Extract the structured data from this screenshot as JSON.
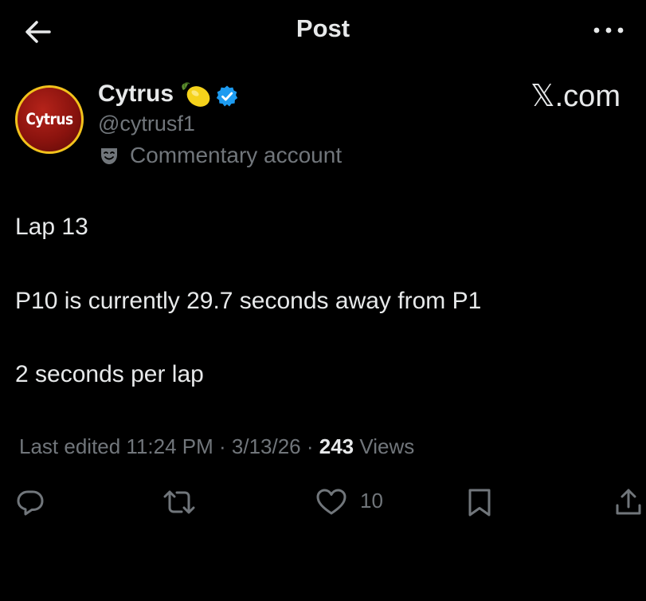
{
  "header": {
    "title": "Post",
    "back_icon": "arrow-left-icon",
    "more_icon": "more-horizontal-icon"
  },
  "author": {
    "avatar_text": "Cytrus",
    "display_name": "Cytrus",
    "name_emoji": "lemon-icon",
    "verified_icon": "verified-badge-icon",
    "handle": "@cytrusf1",
    "account_label_icon": "theater-mask-icon",
    "account_label": "Commentary account"
  },
  "watermark": {
    "x_letter": "𝕏",
    "suffix": ".com"
  },
  "post": {
    "lines": [
      "Lap 13",
      "P10 is currently 29.7 seconds away from P1",
      "2 seconds per lap"
    ]
  },
  "meta": {
    "edited_label": "Last edited 11:24 PM · 3/13/26",
    "separator": " · ",
    "views_count": "243",
    "views_label": " Views"
  },
  "actions": {
    "reply_icon": "reply-icon",
    "repost_icon": "repost-icon",
    "like_icon": "heart-icon",
    "like_count": "10",
    "bookmark_icon": "bookmark-icon",
    "share_icon": "share-icon"
  },
  "colors": {
    "background": "#000000",
    "primary_text": "#e7e9ea",
    "secondary_text": "#71767b",
    "verified": "#1d9bf0",
    "avatar_red": "#b5231a",
    "avatar_ring": "#f2c21c"
  }
}
